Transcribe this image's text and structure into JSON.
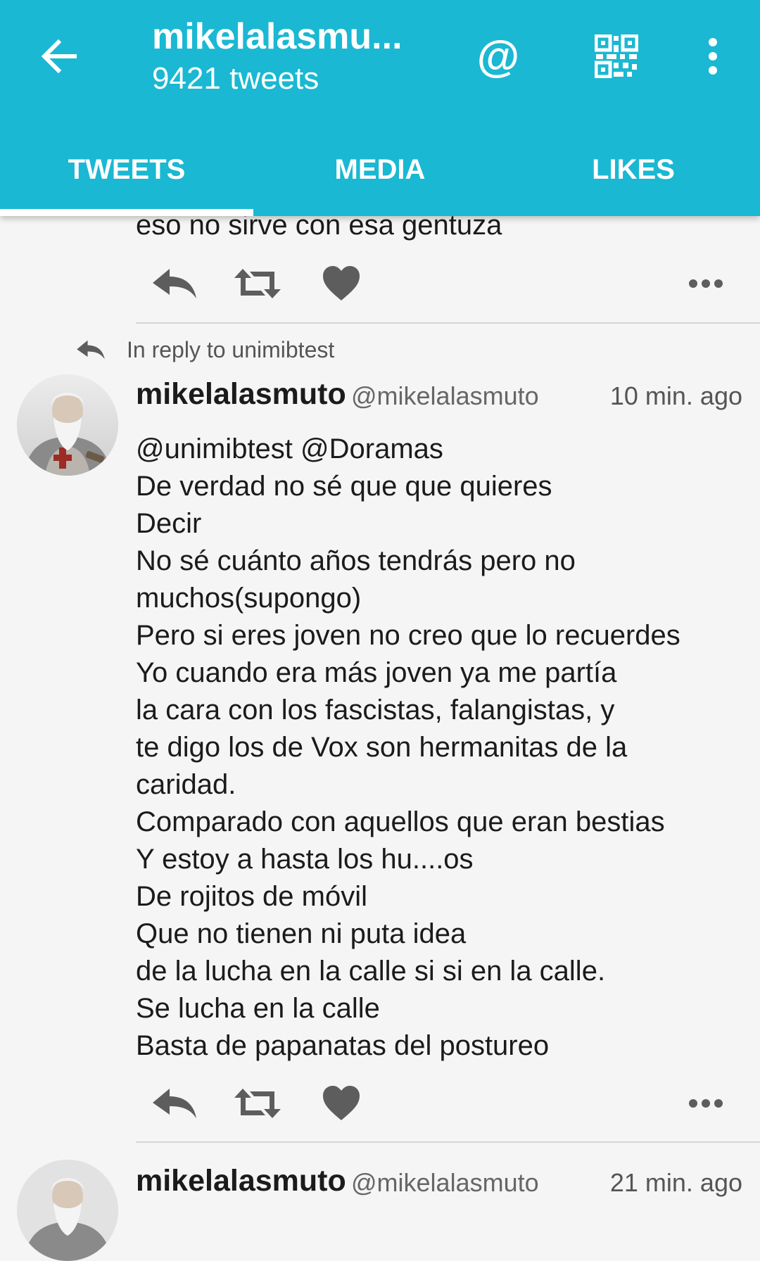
{
  "header": {
    "title": "mikelalasmu...",
    "subtitle": "9421 tweets",
    "accent_color": "#1ab8d2",
    "icons": [
      "back-arrow-icon",
      "at-icon",
      "qr-code-icon",
      "more-vert-icon"
    ],
    "at_symbol": "@"
  },
  "tabs": [
    {
      "label": "TWEETS",
      "selected": true
    },
    {
      "label": "MEDIA",
      "selected": false
    },
    {
      "label": "LIKES",
      "selected": false
    }
  ],
  "timeline": {
    "partial_tweet": {
      "text": "eso no sirve con esa gentuza"
    },
    "tweets": [
      {
        "reply_context": "In reply to unimibtest",
        "display_name": "mikelalasmuto",
        "handle": "@mikelalasmuto",
        "timestamp": "10 min. ago",
        "text": "@unimibtest @Doramas\nDe verdad no sé que que quieres\nDecir\nNo sé cuánto años tendrás pero no\nmuchos(supongo)\nPero si eres joven no creo que lo recuerdes\nYo cuando era más joven ya me partía\nla cara con los fascistas, falangistas, y\nte digo los de Vox son hermanitas de la\ncaridad.\nComparado con aquellos que eran bestias\nY estoy a hasta los hu....os\nDe rojitos de móvil\nQue no tienen ni puta idea\nde la lucha en la calle si si en la calle.\nSe lucha en la calle\nBasta de papanatas del postureo"
      },
      {
        "display_name": "mikelalasmuto",
        "handle": "@mikelalasmuto",
        "timestamp": "21 min. ago"
      }
    ]
  }
}
